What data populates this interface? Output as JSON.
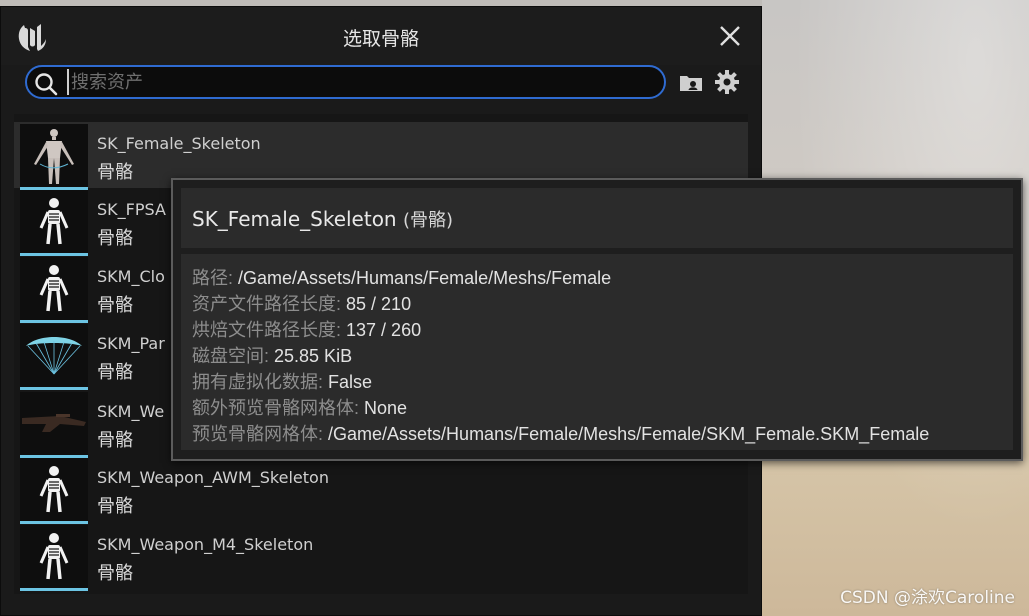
{
  "window": {
    "title": "选取骨骼"
  },
  "search": {
    "placeholder": "搜索资产",
    "value": ""
  },
  "assets": [
    {
      "name": "SK_Female_Skeleton",
      "type": "骨骼",
      "thumb": "female-mannequin",
      "selected": true
    },
    {
      "name": "SK_FPSA",
      "type": "骨骼",
      "thumb": "skeleton-icon"
    },
    {
      "name": "SKM_Clo",
      "type": "骨骼",
      "thumb": "skeleton-icon"
    },
    {
      "name": "SKM_Par",
      "type": "骨骼",
      "thumb": "parachute"
    },
    {
      "name": "SKM_We",
      "type": "骨骼",
      "thumb": "rifle"
    },
    {
      "name": "SKM_Weapon_AWM_Skeleton",
      "type": "骨骼",
      "thumb": "skeleton-icon"
    },
    {
      "name": "SKM_Weapon_M4_Skeleton",
      "type": "骨骼",
      "thumb": "skeleton-icon"
    }
  ],
  "tooltip": {
    "title": "SK_Female_Skeleton",
    "subtitle": "(骨骼)",
    "rows": [
      {
        "key": "路径:",
        "value": " /Game/Assets/Humans/Female/Meshs/Female"
      },
      {
        "key": "资产文件路径长度:",
        "value": " 85 / 210"
      },
      {
        "key": "烘焙文件路径长度:",
        "value": " 137 / 260"
      },
      {
        "key": "磁盘空间:",
        "value": " 25.85 KiB"
      },
      {
        "key": "拥有虚拟化数据:",
        "value": " False"
      },
      {
        "key": "额外预览骨骼网格体:",
        "value": " None"
      },
      {
        "key": "预览骨骼网格体:",
        "value": " /Game/Assets/Humans/Female/Meshs/Female/SKM_Female.SKM_Female"
      }
    ]
  },
  "watermark": "CSDN @涂欢Caroline",
  "colors": {
    "accent_blue": "#2f6bd1",
    "thumb_underline": "#6cc4e3"
  }
}
